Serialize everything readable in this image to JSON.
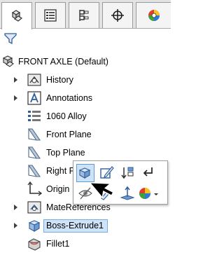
{
  "tabs": [
    {
      "icon": "featuremanager-tree-icon",
      "active": true
    },
    {
      "icon": "propertymanager-icon",
      "active": false
    },
    {
      "icon": "configurationmanager-icon",
      "active": false
    },
    {
      "icon": "dimxpertmanager-icon",
      "active": false
    },
    {
      "icon": "display-manager-icon",
      "active": false
    }
  ],
  "filter": {
    "icon": "filter-icon"
  },
  "tree": {
    "root_label": "FRONT AXLE  (Default)",
    "items": [
      {
        "label": "History",
        "icon": "history-folder-icon",
        "expandable": true
      },
      {
        "label": "Annotations",
        "icon": "annotations-icon",
        "expandable": true
      },
      {
        "label": "1060 Alloy",
        "icon": "material-icon",
        "expandable": false
      },
      {
        "label": "Front Plane",
        "icon": "plane-icon",
        "expandable": false
      },
      {
        "label": "Top Plane",
        "icon": "plane-icon",
        "expandable": false
      },
      {
        "label": "Right P",
        "icon": "plane-icon",
        "expandable": false
      },
      {
        "label": "Origin",
        "icon": "origin-icon",
        "expandable": false
      },
      {
        "label": "MateReferences",
        "icon": "mate-references-icon",
        "expandable": true
      },
      {
        "label": "Boss-Extrude1",
        "icon": "boss-extrude-icon",
        "expandable": true,
        "selected": true
      },
      {
        "label": "Fillet1",
        "icon": "fillet-icon",
        "expandable": false
      }
    ]
  },
  "context_toolbar": {
    "buttons": [
      {
        "icon": "edit-feature-icon",
        "highlighted": true
      },
      {
        "icon": "edit-sketch-icon"
      },
      {
        "icon": "rollback-icon"
      },
      {
        "icon": "parent-child-icon"
      },
      {
        "icon": "hide-icon"
      },
      {
        "icon": "appearance-icon"
      },
      {
        "icon": "normal-to-icon"
      },
      {
        "icon": "color-appearance-dropdown-icon"
      }
    ]
  },
  "colors": {
    "accent": "#5d9be0",
    "selection": "#cfe3f8",
    "tab_bg": "#e3e3e3"
  }
}
